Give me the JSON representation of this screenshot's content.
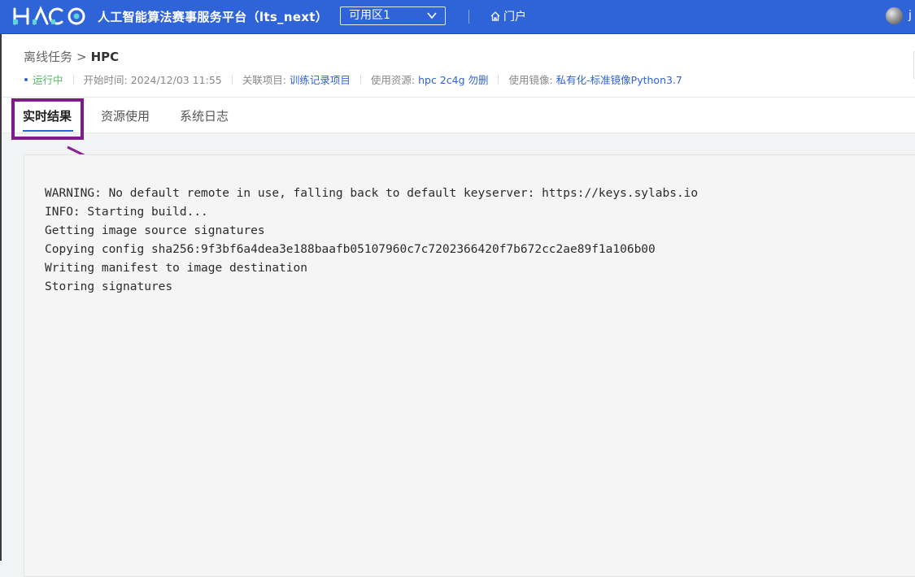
{
  "topbar": {
    "app_title": "人工智能算法赛事服务平台（lts_next）",
    "zone_select": "可用区1",
    "portal_label": "门户",
    "username": "j",
    "brand_color": "#2f63d8",
    "icons": [
      "logo",
      "chevron-down-icon",
      "home-icon",
      "avatar"
    ]
  },
  "header": {
    "breadcrumb_parent": "离线任务",
    "breadcrumb_separator": ">",
    "breadcrumb_current": "HPC",
    "status": "运行中",
    "start_time_label": "开始时间:",
    "start_time": "2024/12/03 11:55",
    "project_label": "关联项目:",
    "project": "训练记录项目",
    "resource_label": "使用资源:",
    "resource": "hpc 2c4g 勿删",
    "image_label": "使用镜像:",
    "image": "私有化-标准镜像Python3.7",
    "status_color": "#52b869"
  },
  "tabs": [
    {
      "label": "实时结果",
      "active": true
    },
    {
      "label": "资源使用",
      "active": false
    },
    {
      "label": "系统日志",
      "active": false
    }
  ],
  "annotation": {
    "color": "#7f1a8a"
  },
  "log_lines": [
    "WARNING: No default remote in use, falling back to default keyserver: https://keys.sylabs.io",
    "INFO: Starting build...",
    "Getting image source signatures",
    "Copying config sha256:9f3bf6a4dea3e188baafb05107960c7c7202366420f7b672cc2ae89f1a106b00",
    "Writing manifest to image destination",
    "Storing signatures"
  ]
}
